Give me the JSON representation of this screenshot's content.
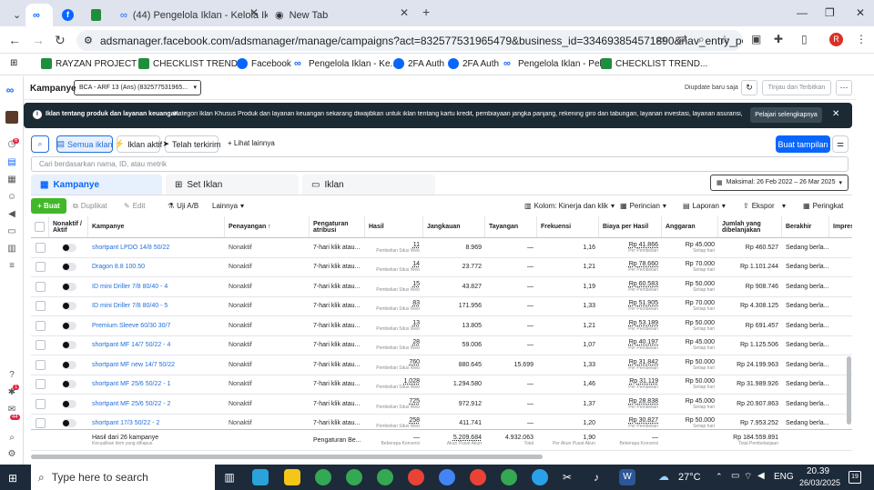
{
  "browser": {
    "tabs": [
      {
        "title": "",
        "icon": "meta-icon"
      },
      {
        "title": "",
        "icon": "facebook-icon"
      },
      {
        "title": "",
        "icon": "sheets-icon"
      },
      {
        "title": "(44) Pengelola Iklan - Kelola Ikla",
        "icon": "meta-icon"
      },
      {
        "title": "New Tab",
        "icon": "chrome-icon"
      }
    ],
    "url": "adsmanager.facebook.com/adsmanager/manage/campaigns?act=832577531965479&business_id=334693854571890&nav_entry_point=...",
    "bookmarks": [
      "RAYZAN PROJECT -...",
      "CHECKLIST TREND...",
      "Facebook",
      "Pengelola Iklan - Ke...",
      "2FA Auth",
      "2FA Auth",
      "Pengelola Iklan - Pel...",
      "CHECKLIST TREND..."
    ],
    "profile_initial": "R"
  },
  "header": {
    "title": "Kampanye",
    "account": "BCA - ARF 13 (Ans) (832577531965...",
    "updated": "Diupdate baru saja",
    "review_button": "Tinjau dan Terbitkan"
  },
  "banner": {
    "title": "Iklan tentang produk dan layanan keuangan",
    "text": "Kategori Iklan Khusus Produk dan layanan keuangan sekarang diwajibkan untuk iklan tentang kartu kredit, pembiayaan jangka panjang, rekening giro dan tabungan, layanan investasi, layanan asuransi, serta produk",
    "button": "Pelajari selengkapnya"
  },
  "filters": {
    "all": "Semua iklan",
    "active": "Iklan aktif",
    "recent": "Telah terkirim",
    "more": "+ Lihat lainnya",
    "show_chart": "Buat tampilan",
    "search_placeholder": "Cari berdasarkan nama, ID, atau metrik"
  },
  "level_tabs": {
    "campaigns": "Kampanye",
    "adsets": "Set Iklan",
    "ads": "Iklan",
    "date_range": "Maksimal: 26 Feb 2022 – 26 Mar 2025"
  },
  "actions": {
    "create": "+ Buat",
    "duplicate": "Duplikat",
    "edit": "Edit",
    "ab_test": "Uji A/B",
    "more": "Lainnya",
    "columns": "Kolom: Kinerja dan klik",
    "breakdown": "Perincian",
    "reports": "Laporan",
    "export": "Ekspor",
    "summary": "Peringkat"
  },
  "table": {
    "headers": [
      "Nonaktif / Aktif",
      "Kampanye",
      "Penayangan ↑",
      "Pengaturan atribusi",
      "Hasil",
      "Jangkauan",
      "Tayangan",
      "Frekuensi",
      "Biaya per Hasil",
      "Anggaran",
      "Jumlah yang dibelanjakan",
      "Berakhir",
      "Impres"
    ],
    "rows": [
      {
        "name": "shortpant LPDO 14/8 50/22",
        "status": "Nonaktif",
        "attr": "7-hari klik atau...",
        "result": "11",
        "reach": "8.969",
        "impr": "—",
        "freq": "1,16",
        "cpr": "Rp 41.866",
        "budget": "Rp 45.000",
        "spent": "Rp 460.527",
        "end": "Sedang berla..."
      },
      {
        "name": "Dragon 8.8 100.50",
        "status": "Nonaktif",
        "attr": "7-hari klik atau...",
        "result": "14",
        "reach": "23.772",
        "impr": "—",
        "freq": "1,21",
        "cpr": "Rp 78.660",
        "budget": "Rp 70.000",
        "spent": "Rp 1.101.244",
        "end": "Sedang berla..."
      },
      {
        "name": "ID mini Driller 7/8 80/40 - 4",
        "status": "Nonaktif",
        "attr": "7-hari klik atau...",
        "result": "15",
        "reach": "43.827",
        "impr": "—",
        "freq": "1,19",
        "cpr": "Rp 60.583",
        "budget": "Rp 50.000",
        "spent": "Rp 908.746",
        "end": "Sedang berla..."
      },
      {
        "name": "ID mini Driller 7/8 80/40 - 5",
        "status": "Nonaktif",
        "attr": "7-hari klik atau...",
        "result": "83",
        "reach": "171.956",
        "impr": "—",
        "freq": "1,33",
        "cpr": "Rp 51.905",
        "budget": "Rp 70.000",
        "spent": "Rp 4.308.125",
        "end": "Sedang berla..."
      },
      {
        "name": "Premium Sleeve 60/30 30/7",
        "status": "Nonaktif",
        "attr": "7-hari klik atau...",
        "result": "13",
        "reach": "13.805",
        "impr": "—",
        "freq": "1,21",
        "cpr": "Rp 53.189",
        "budget": "Rp 50.000",
        "spent": "Rp 691.457",
        "end": "Sedang berla..."
      },
      {
        "name": "shortpant MF 14/7 50/22 - 4",
        "status": "Nonaktif",
        "attr": "7-hari klik atau...",
        "result": "28",
        "reach": "59.006",
        "impr": "—",
        "freq": "1,07",
        "cpr": "Rp 40.197",
        "budget": "Rp 45.000",
        "spent": "Rp 1.125.506",
        "end": "Sedang berla..."
      },
      {
        "name": "shortpant MF new 14/7 50/22",
        "status": "Nonaktif",
        "attr": "7-hari klik atau...",
        "result": "760",
        "reach": "880.645",
        "impr": "15.699",
        "freq": "1,33",
        "cpr": "Rp 31.842",
        "budget": "Rp 50.000",
        "spent": "Rp 24.199.963",
        "end": "Sedang berla..."
      },
      {
        "name": "shortpant MF 25/6 50/22 - 1",
        "status": "Nonaktif",
        "attr": "7-hari klik atau...",
        "result": "1.028",
        "reach": "1.294.580",
        "impr": "—",
        "freq": "1,46",
        "cpr": "Rp 31.119",
        "budget": "Rp 50.000",
        "spent": "Rp 31.989.926",
        "end": "Sedang berla..."
      },
      {
        "name": "shortpant MF 25/6 50/22 - 2",
        "status": "Nonaktif",
        "attr": "7-hari klik atau...",
        "result": "725",
        "reach": "972.912",
        "impr": "—",
        "freq": "1,37",
        "cpr": "Rp 28.838",
        "budget": "Rp 45.000",
        "spent": "Rp 20.907.863",
        "end": "Sedang berla..."
      },
      {
        "name": "shortpant 17/3 50/22 - 2",
        "status": "Nonaktif",
        "attr": "7-hari klik atau...",
        "result": "258",
        "reach": "411.741",
        "impr": "—",
        "freq": "1,20",
        "cpr": "Rp 30.827",
        "budget": "Rp 50.000",
        "spent": "Rp 7.953.252",
        "end": "Sedang berla..."
      }
    ],
    "result_sub": "Pembelian Situs Web",
    "cpr_sub": "Per Pembelian",
    "budget_sub": "Setiap hari",
    "total": {
      "label": "Hasil dari 26 kampanye",
      "sub": "Kecualikan item yang dihapus",
      "attr": "Pengaturan Be...",
      "result": "—",
      "result_sub": "Beberapa Konversi",
      "reach": "5.209.684",
      "reach_sub": "Akun Pusat Akun",
      "impr": "4.932.063",
      "impr_sub": "Total",
      "freq": "1,90",
      "freq_sub": "Per Akun Pusat Akun",
      "cpr": "—",
      "cpr_sub": "Beberapa Konversi",
      "spent": "Rp 184.559.891",
      "spent_sub": "Total Pembelanjaan"
    }
  },
  "taskbar": {
    "search": "Type here to search",
    "weather": "27°C",
    "lang": "ENG",
    "time": "20.39",
    "date": "26/03/2025",
    "notif": "19"
  },
  "rail_badges": [
    "6",
    "1",
    "44"
  ]
}
